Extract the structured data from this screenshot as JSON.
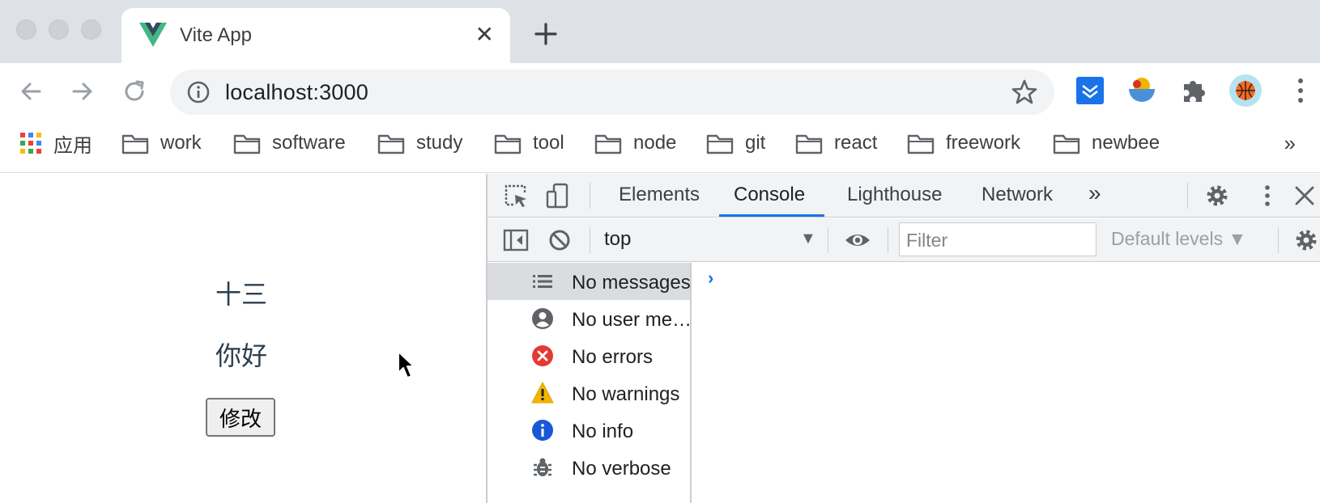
{
  "tab": {
    "title": "Vite App"
  },
  "address_bar": {
    "url": "localhost:3000"
  },
  "bookmarks": {
    "apps_label": "应用",
    "folders": [
      "work",
      "software",
      "study",
      "tool",
      "node",
      "git",
      "react",
      "freework",
      "newbee"
    ]
  },
  "page": {
    "line1": "十三",
    "line2": "你好",
    "button_label": "修改"
  },
  "devtools": {
    "tabs": [
      "Elements",
      "Console",
      "Lighthouse",
      "Network"
    ],
    "active_tab": "Console",
    "context": "top",
    "filter_placeholder": "Filter",
    "levels_label": "Default levels ▼",
    "sidebar": [
      {
        "label": "No messages",
        "icon": "list-icon"
      },
      {
        "label": "No user me…",
        "icon": "user-icon"
      },
      {
        "label": "No errors",
        "icon": "error-icon"
      },
      {
        "label": "No warnings",
        "icon": "warning-icon"
      },
      {
        "label": "No info",
        "icon": "info-icon"
      },
      {
        "label": "No verbose",
        "icon": "bug-icon"
      }
    ],
    "prompt_symbol": "›"
  },
  "colors": {
    "accent": "#1a73e8",
    "vue_green": "#41b883",
    "vue_dark": "#35495e",
    "error": "#e53935",
    "warning": "#f2b600",
    "info": "#1a57d6"
  }
}
